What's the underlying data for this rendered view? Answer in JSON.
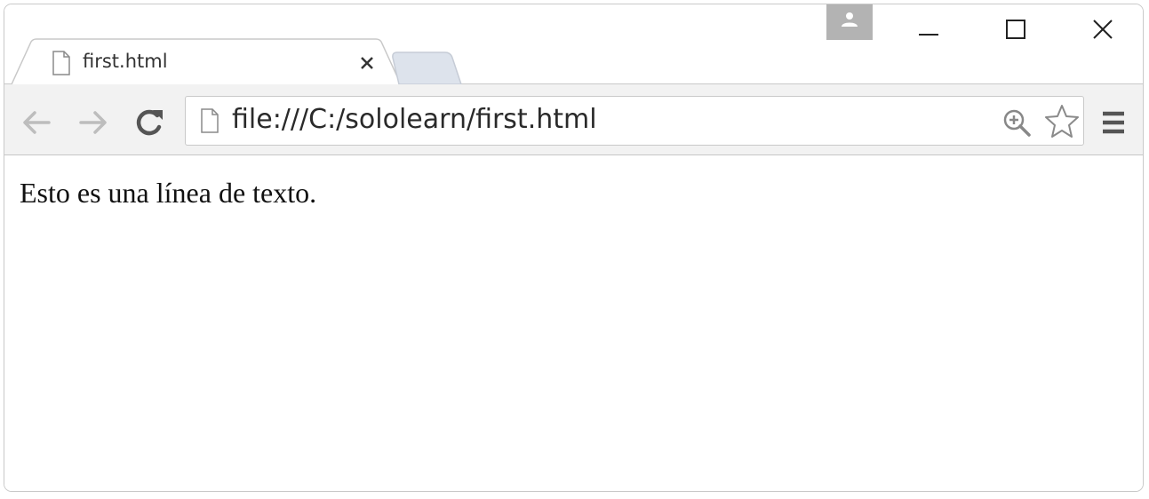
{
  "tab": {
    "title": "first.html"
  },
  "address_bar": {
    "scheme_host": "file:///",
    "path": "C:/sololearn/first.html"
  },
  "page": {
    "text": "Esto es una línea de texto."
  },
  "icons": {
    "tab": "document-icon",
    "address": "document-icon",
    "zoom": "zoom-in-icon",
    "bookmark": "star-icon",
    "menu": "hamburger-menu-icon",
    "profile": "user-icon",
    "back": "arrow-left-icon",
    "forward": "arrow-right-icon",
    "reload": "reload-icon"
  },
  "colors": {
    "toolbar_bg": "#f2f2f2",
    "profile_bg": "#b3b3b3",
    "nav_disabled": "#bdbdbd",
    "reload": "#555555",
    "newtab_fill": "#dde3ec"
  }
}
